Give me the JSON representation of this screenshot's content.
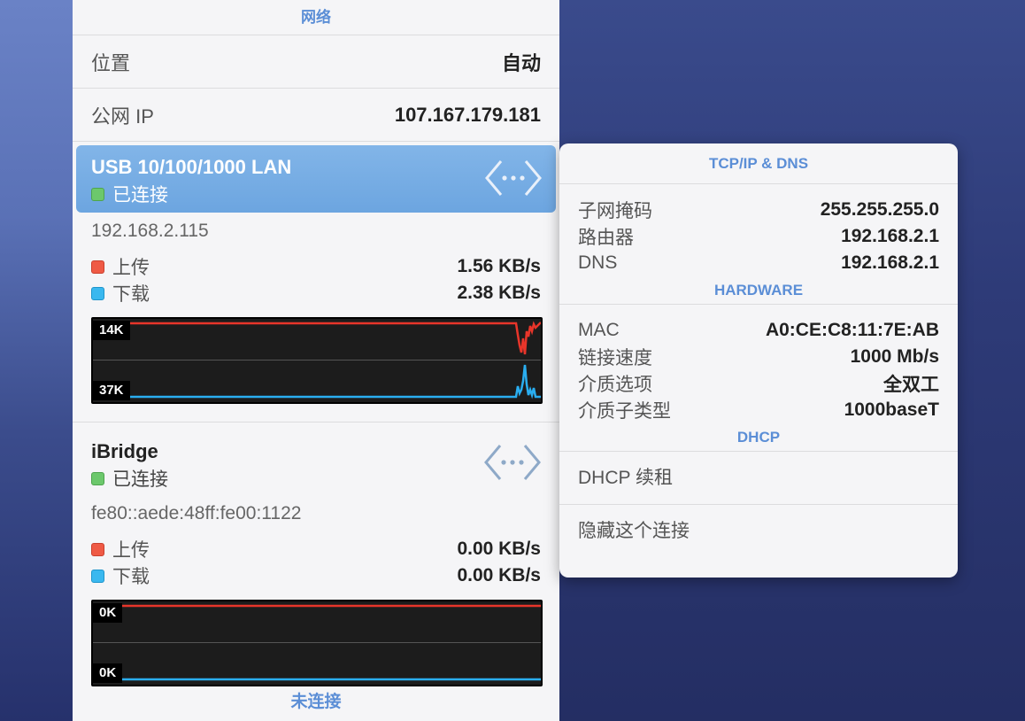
{
  "network": {
    "title": "网络",
    "location": {
      "label": "位置",
      "value": "自动"
    },
    "public_ip": {
      "label": "公网 IP",
      "value": "107.167.179.181"
    },
    "interfaces": [
      {
        "name": "USB 10/100/1000 LAN",
        "status": "已连接",
        "ip": "192.168.2.115",
        "upload_label": "上传",
        "upload_value": "1.56 KB/s",
        "download_label": "下载",
        "download_value": "2.38 KB/s",
        "graph_top_label": "14K",
        "graph_bottom_label": "37K"
      },
      {
        "name": "iBridge",
        "status": "已连接",
        "ip": "fe80::aede:48ff:fe00:1122",
        "upload_label": "上传",
        "upload_value": "0.00 KB/s",
        "download_label": "下载",
        "download_value": "0.00 KB/s",
        "graph_top_label": "0K",
        "graph_bottom_label": "0K"
      }
    ],
    "footer": "未连接"
  },
  "details": {
    "tcpip_title": "TCP/IP & DNS",
    "tcpip": [
      {
        "label": "子网掩码",
        "value": "255.255.255.0"
      },
      {
        "label": "路由器",
        "value": "192.168.2.1"
      },
      {
        "label": "DNS",
        "value": "192.168.2.1"
      }
    ],
    "hardware_title": "HARDWARE",
    "hardware": [
      {
        "label": "MAC",
        "value": "A0:CE:C8:11:7E:AB"
      },
      {
        "label": "链接速度",
        "value": "1000 Mb/s"
      },
      {
        "label": "介质选项",
        "value": "全双工"
      },
      {
        "label": "介质子类型",
        "value": "1000baseT"
      }
    ],
    "dhcp_title": "DHCP",
    "actions": [
      {
        "label": "DHCP 续租"
      },
      {
        "label": "隐藏这个连接"
      }
    ]
  },
  "colors": {
    "accent": "#5b8ed6",
    "selected": "#6ca5e0",
    "upload": "#e8352a",
    "download": "#2aaef0",
    "connected": "#6cc86c"
  },
  "icons": {
    "connection": "ethernet-connection-icon",
    "status": "status-dot-icon"
  }
}
